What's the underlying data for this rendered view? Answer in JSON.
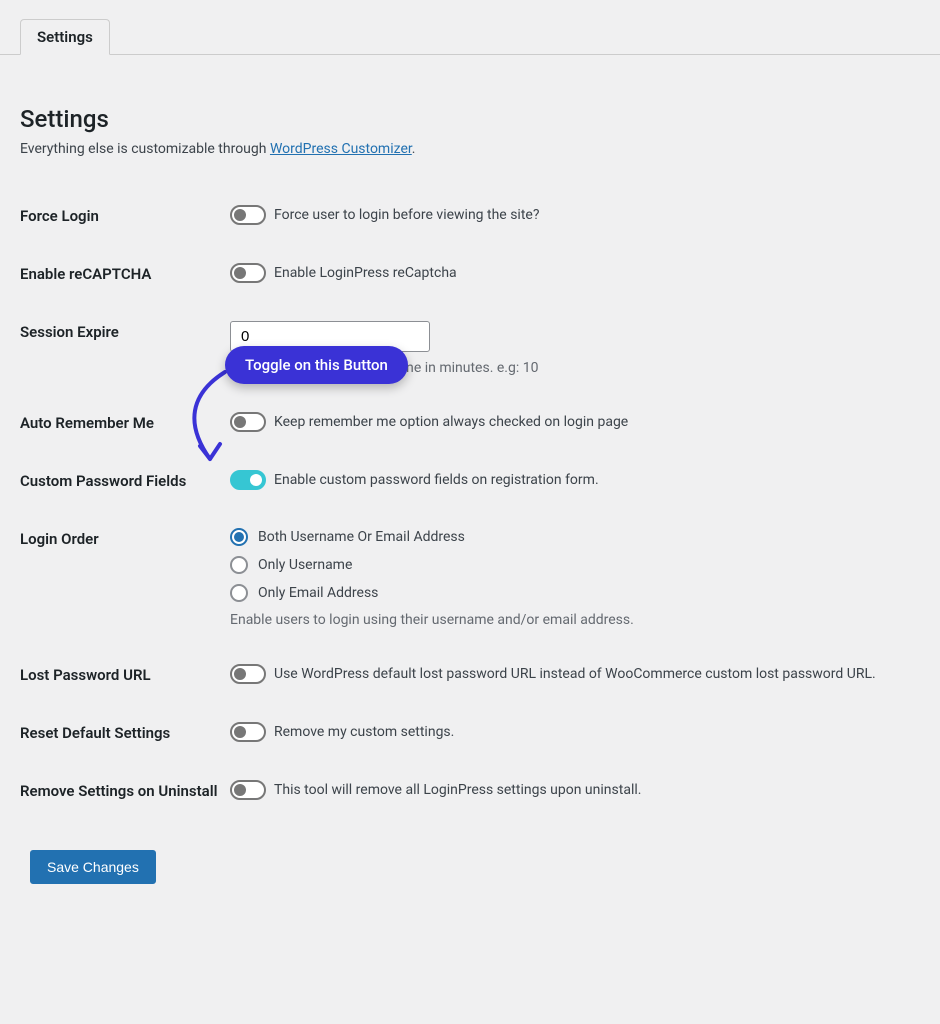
{
  "tab": {
    "label": "Settings"
  },
  "page": {
    "title": "Settings",
    "intro_prefix": "Everything else is customizable through ",
    "intro_link": "WordPress Customizer",
    "intro_suffix": "."
  },
  "tooltip": {
    "text": "Toggle on this Button"
  },
  "fields": {
    "force_login": {
      "label": "Force Login",
      "desc": "Force user to login before viewing the site?",
      "on": false
    },
    "enable_recaptcha": {
      "label": "Enable reCAPTCHA",
      "desc": "Enable LoginPress reCaptcha",
      "on": false
    },
    "session_expire": {
      "label": "Session Expire",
      "value": "0",
      "help": "Set the session expiration time in minutes. e.g: 10"
    },
    "auto_remember": {
      "label": "Auto Remember Me",
      "desc": "Keep remember me option always checked on login page",
      "on": false
    },
    "custom_password": {
      "label": "Custom Password Fields",
      "desc": "Enable custom password fields on registration form.",
      "on": true
    },
    "login_order": {
      "label": "Login Order",
      "options": [
        {
          "label": "Both Username Or Email Address",
          "checked": true
        },
        {
          "label": "Only Username",
          "checked": false
        },
        {
          "label": "Only Email Address",
          "checked": false
        }
      ],
      "help": "Enable users to login using their username and/or email address."
    },
    "lost_password": {
      "label": "Lost Password URL",
      "desc": "Use WordPress default lost password URL instead of WooCommerce custom lost password URL.",
      "on": false
    },
    "reset_defaults": {
      "label": "Reset Default Settings",
      "desc": "Remove my custom settings.",
      "on": false
    },
    "remove_on_uninstall": {
      "label": "Remove Settings on Uninstall",
      "desc": "This tool will remove all LoginPress settings upon uninstall.",
      "on": false
    }
  },
  "actions": {
    "save": "Save Changes"
  }
}
